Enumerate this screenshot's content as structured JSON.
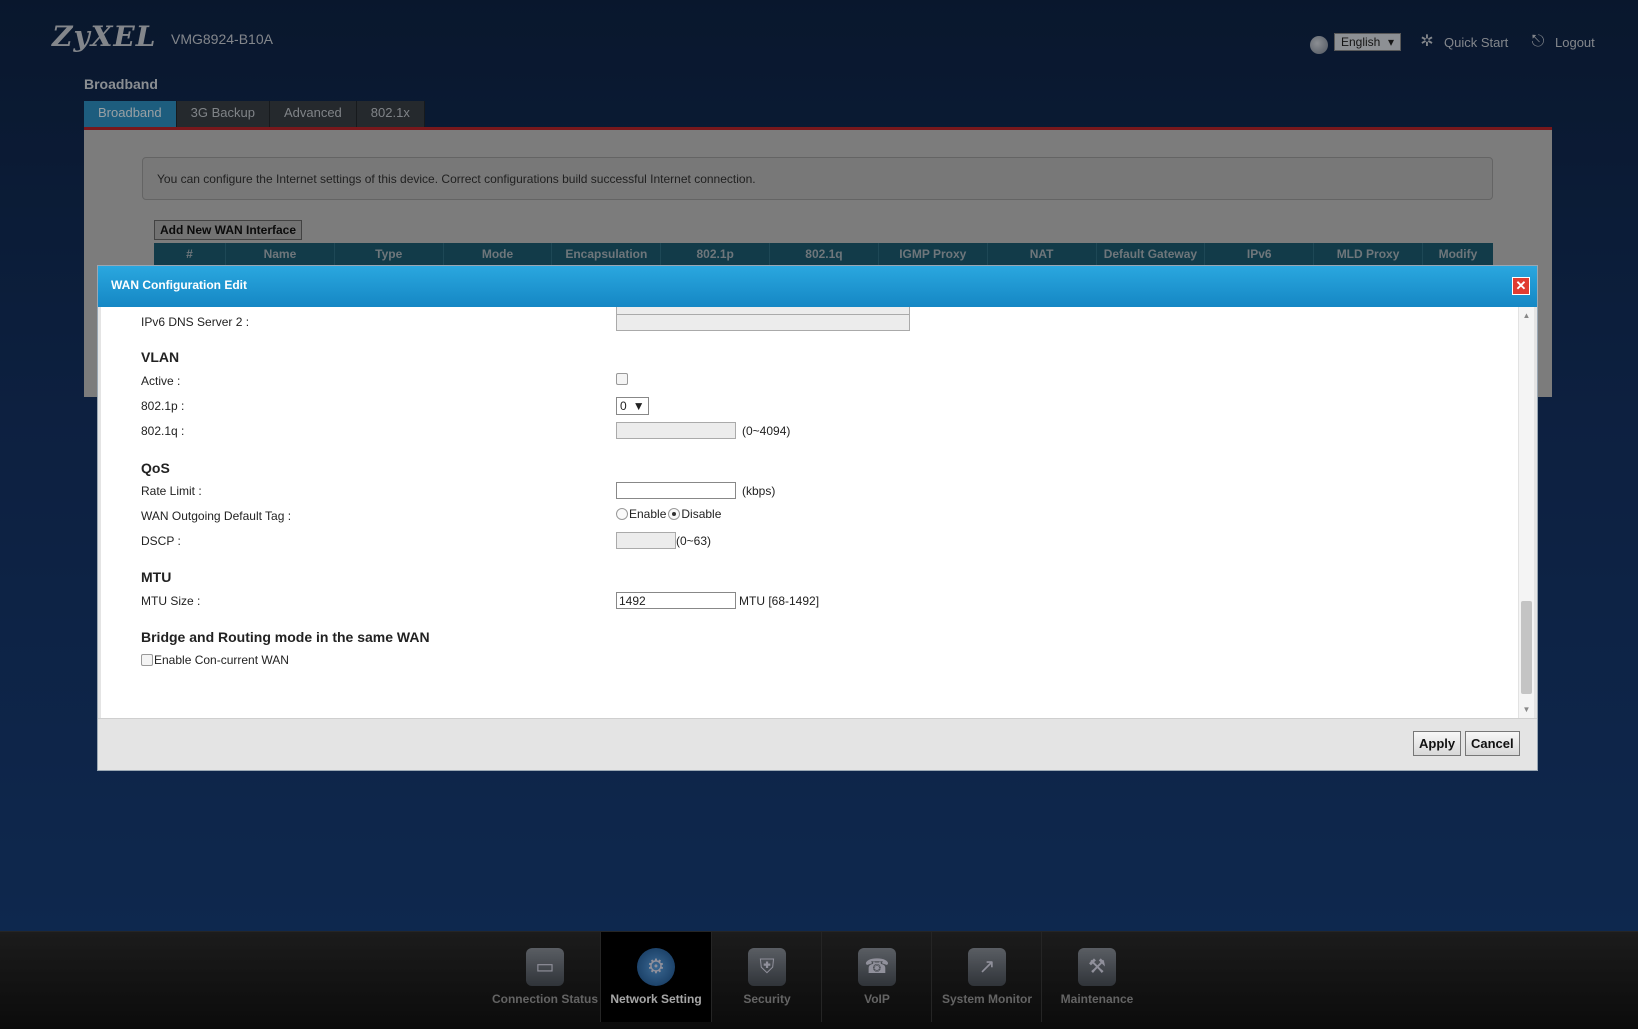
{
  "header": {
    "logo": "ZyXEL",
    "model": "VMG8924-B10A",
    "language": "English",
    "quick_start": "Quick Start",
    "logout": "Logout"
  },
  "page": {
    "section_title": "Broadband",
    "tabs": [
      {
        "label": "Broadband",
        "active": true
      },
      {
        "label": "3G Backup",
        "active": false
      },
      {
        "label": "Advanced",
        "active": false
      },
      {
        "label": "802.1x",
        "active": false
      }
    ],
    "info_text": "You can configure the Internet settings of this device. Correct configurations build successful Internet connection.",
    "add_wan_label": "Add New WAN Interface",
    "table_headers": [
      "#",
      "Name",
      "Type",
      "Mode",
      "Encapsulation",
      "802.1p",
      "802.1q",
      "IGMP Proxy",
      "NAT",
      "Default Gateway",
      "IPv6",
      "MLD Proxy",
      "Modify"
    ]
  },
  "modal": {
    "title": "WAN Configuration Edit",
    "ipv6_dns2_label": "IPv6 DNS Server 2 :",
    "vlan": {
      "heading": "VLAN",
      "active_label": "Active :",
      "p_label": "802.1p :",
      "p_value": "0",
      "q_label": "802.1q :",
      "q_hint": "(0~4094)"
    },
    "qos": {
      "heading": "QoS",
      "rate_label": "Rate Limit :",
      "rate_unit": "(kbps)",
      "tag_label": "WAN Outgoing Default Tag :",
      "enable_label": "Enable",
      "disable_label": "Disable",
      "dscp_label": "DSCP :",
      "dscp_hint": "(0~63)"
    },
    "mtu": {
      "heading": "MTU",
      "size_label": "MTU Size :",
      "size_value": "1492",
      "size_hint": "MTU [68-1492]"
    },
    "bridge": {
      "heading": "Bridge and Routing mode in the same WAN",
      "concurrent_label": "Enable Con-current WAN"
    },
    "apply_label": "Apply",
    "cancel_label": "Cancel"
  },
  "bottom_nav": [
    {
      "label": "Connection Status",
      "icon": "monitor-icon",
      "active": false
    },
    {
      "label": "Network Setting",
      "icon": "globe-gear-icon",
      "active": true
    },
    {
      "label": "Security",
      "icon": "shield-icon",
      "active": false
    },
    {
      "label": "VoIP",
      "icon": "phone-icon",
      "active": false
    },
    {
      "label": "System Monitor",
      "icon": "chart-monitor-icon",
      "active": false
    },
    {
      "label": "Maintenance",
      "icon": "tools-icon",
      "active": false
    }
  ]
}
